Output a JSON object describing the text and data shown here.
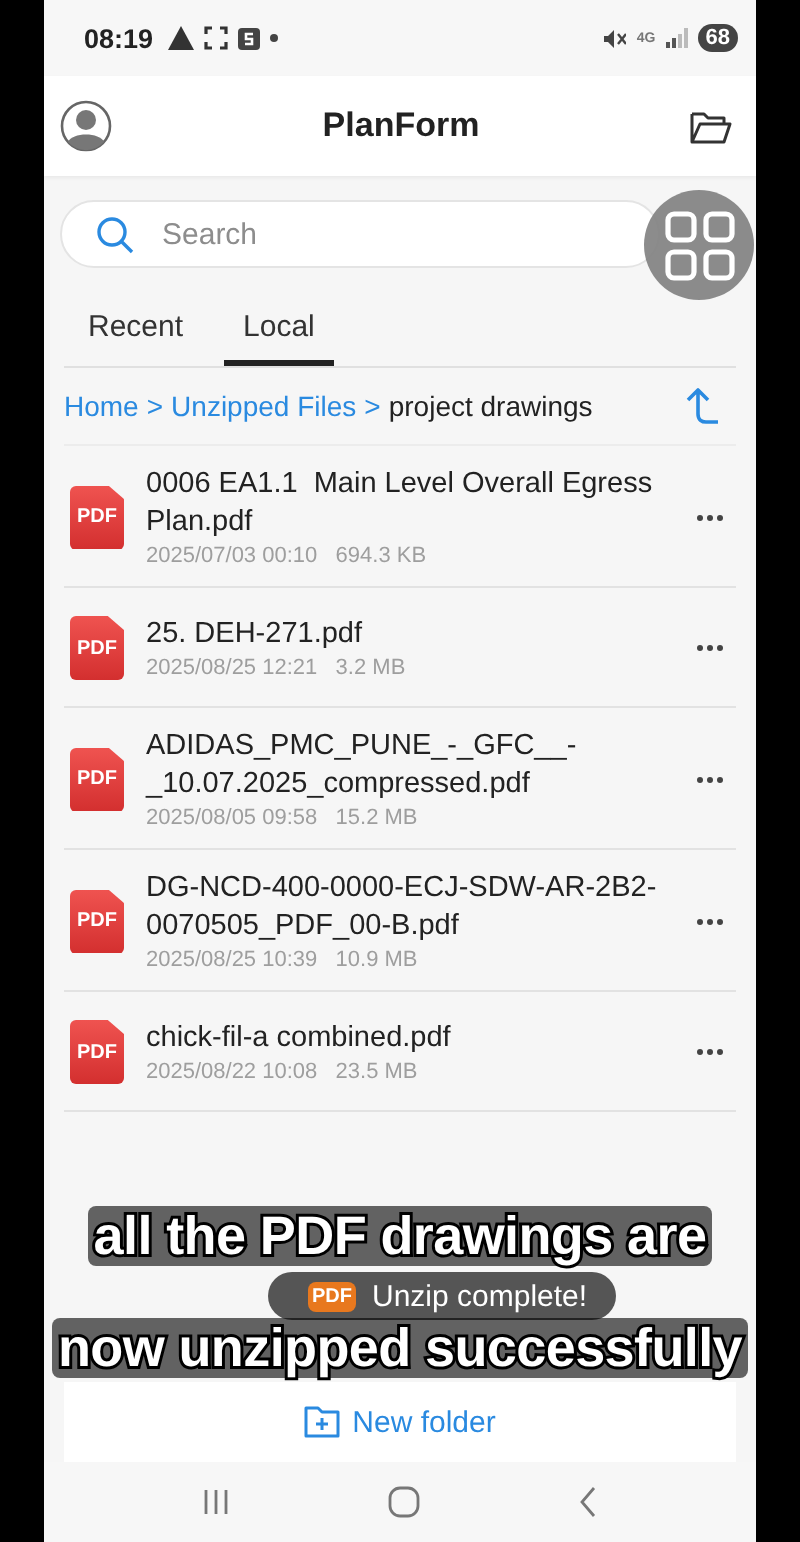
{
  "status_bar": {
    "time": "08:19",
    "network": "4G",
    "battery": "68"
  },
  "header": {
    "title": "PlanForm"
  },
  "search": {
    "placeholder": "Search"
  },
  "tabs": [
    {
      "label": "Recent",
      "selected": false
    },
    {
      "label": "Local",
      "selected": true
    }
  ],
  "breadcrumb": [
    {
      "label": "Home",
      "kind": "link"
    },
    {
      "label": ">",
      "kind": "separator"
    },
    {
      "label": "Unzipped Files",
      "kind": "link"
    },
    {
      "label": ">",
      "kind": "separator"
    },
    {
      "label": "project drawings",
      "kind": "current"
    }
  ],
  "files": [
    {
      "badge": "PDF",
      "name": "0006 EA1.1  Main Level Overall Egress Plan.pdf",
      "date": "2025/07/03 00:10",
      "size": "694.3 KB"
    },
    {
      "badge": "PDF",
      "name": "25. DEH-271.pdf",
      "date": "2025/08/25 12:21",
      "size": "3.2 MB"
    },
    {
      "badge": "PDF",
      "name": "ADIDAS_PMC_PUNE_-_GFC__-_10.07.2025_compressed.pdf",
      "date": "2025/08/05 09:58",
      "size": "15.2 MB"
    },
    {
      "badge": "PDF",
      "name": "DG-NCD-400-0000-ECJ-SDW-AR-2B2-0070505_PDF_00-B.pdf",
      "date": "2025/08/25 10:39",
      "size": "10.9 MB"
    },
    {
      "badge": "PDF",
      "name": "chick-fil-a combined.pdf",
      "date": "2025/08/22 10:08",
      "size": "23.5 MB"
    }
  ],
  "toast": {
    "icon_label": "PDF",
    "text": "Unzip complete!"
  },
  "new_folder": {
    "label": "New folder"
  },
  "caption": {
    "lines": [
      "all the PDF drawings are",
      "now unzipped successfully"
    ]
  }
}
